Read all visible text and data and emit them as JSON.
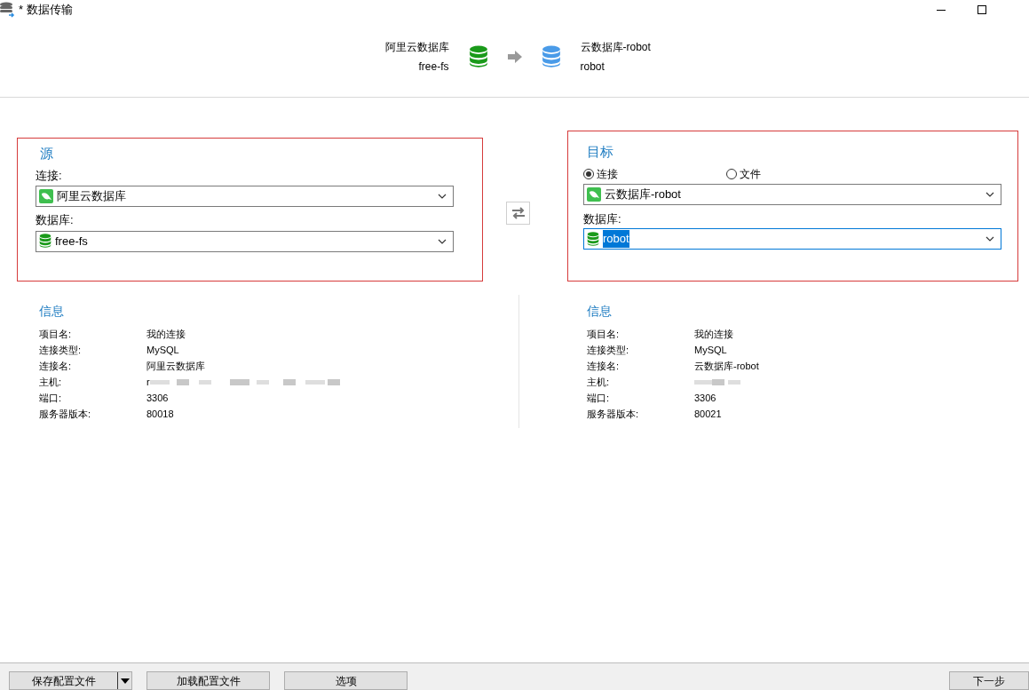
{
  "window": {
    "title": "* 数据传输"
  },
  "header": {
    "source_name": "阿里云数据库",
    "source_db": "free-fs",
    "target_name": "云数据库-robot",
    "target_db": "robot"
  },
  "source": {
    "title": "源",
    "connection_label": "连接:",
    "connection": "阿里云数据库",
    "database_label": "数据库:",
    "database": "free-fs"
  },
  "target": {
    "title": "目标",
    "modes": [
      {
        "label": "连接",
        "selected": true
      },
      {
        "label": "文件",
        "selected": false
      }
    ],
    "connection": "云数据库-robot",
    "database_label": "数据库:",
    "database": "robot",
    "database_focused": true,
    "database_text_selected": true
  },
  "info": [
    {
      "title": "信息",
      "rows": [
        {
          "label": "项目名:",
          "value": "我的连接"
        },
        {
          "label": "连接类型:",
          "value": "MySQL"
        },
        {
          "label": "连接名:",
          "value": "阿里云数据库"
        },
        {
          "label": "主机:",
          "value": "r",
          "blurred": true
        },
        {
          "label": "端口:",
          "value": "3306"
        },
        {
          "label": "服务器版本:",
          "value": "80018"
        }
      ]
    },
    {
      "title": "信息",
      "rows": [
        {
          "label": "项目名:",
          "value": "我的连接"
        },
        {
          "label": "连接类型:",
          "value": "MySQL"
        },
        {
          "label": "连接名:",
          "value": "云数据库-robot"
        },
        {
          "label": "主机:",
          "blurred": true
        },
        {
          "label": "端口:",
          "value": "3306"
        },
        {
          "label": "服务器版本:",
          "value": "80021"
        }
      ]
    }
  ],
  "buttons": [
    {
      "label": "保存配置文件",
      "kind": "split"
    },
    {
      "label": "加载配置文件",
      "kind": "plain"
    },
    {
      "label": "选项",
      "kind": "plain"
    }
  ],
  "next_button": "下一步"
}
